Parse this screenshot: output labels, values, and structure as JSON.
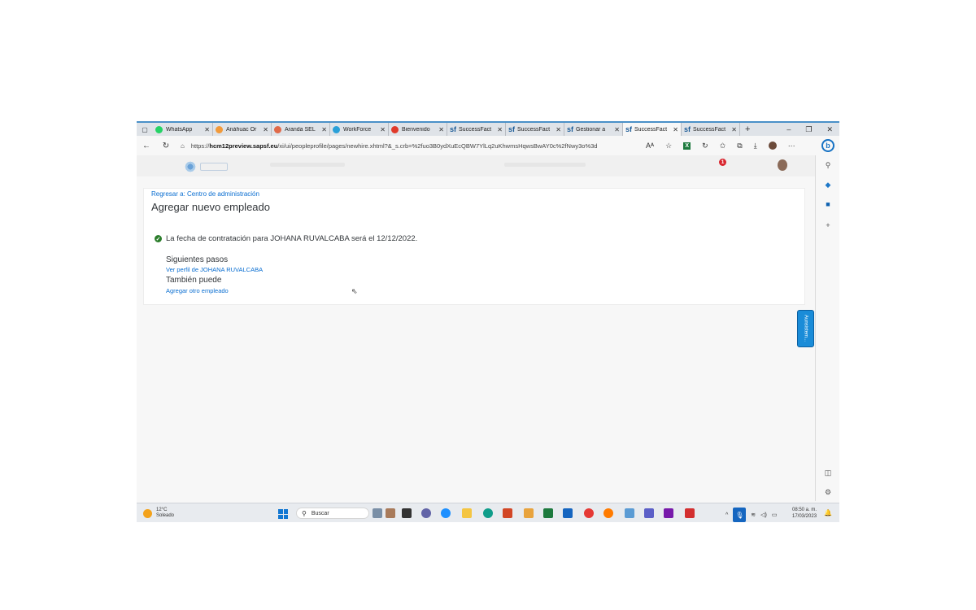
{
  "browser": {
    "tabs": [
      {
        "label": "WhatsApp",
        "icon": "whatsapp-icon",
        "color": "#25d366"
      },
      {
        "label": "Anáhuac Or",
        "icon": "anahuac-icon",
        "color": "#f29a3a"
      },
      {
        "label": "Aranda SEL",
        "icon": "aranda-icon",
        "color": "#e06a4a"
      },
      {
        "label": "WorkForce",
        "icon": "workforce-icon",
        "color": "#2aa0d8"
      },
      {
        "label": "Bienvenido",
        "icon": "bienvenido-icon",
        "color": "#e03a2a"
      },
      {
        "label": "SuccessFact",
        "icon": "successfactors-icon",
        "color": "#1a5a96"
      },
      {
        "label": "SuccessFact",
        "icon": "successfactors-icon",
        "color": "#1a5a96"
      },
      {
        "label": "Gestionar a",
        "icon": "successfactors-icon",
        "color": "#1a5a96"
      },
      {
        "label": "SuccessFact",
        "icon": "successfactors-icon",
        "color": "#1a5a96",
        "active": true
      },
      {
        "label": "SuccessFact",
        "icon": "successfactors-icon",
        "color": "#1a5a96"
      }
    ],
    "url_prefix": "https://",
    "url_domain": "hcm12preview.sapsf.eu",
    "url_path": "/xi/ui/peopleprofile/pages/newhire.xhtml?&_s.crb=%2fuo3B0ydXuEcQBW7YlLq2uKhwmsHqwsBwAY0c%2fNwy3o%3d"
  },
  "sf_header": {
    "notification_count": "1"
  },
  "page": {
    "back_link": "Regresar a: Centro de administración",
    "title": "Agregar nuevo empleado",
    "success_message": "La fecha de contratación para JOHANA RUVALCABA será el 12/12/2022.",
    "next_steps_heading": "Siguientes pasos",
    "profile_link": "Ver perfil de JOHANA RUVALCABA",
    "also_heading": "También puede",
    "add_another_link": "Agregar otro empleado",
    "side_button": "Aunsistem..."
  },
  "taskbar": {
    "temperature": "12°C",
    "weather": "Soleado",
    "search": "Buscar",
    "time": "08:50 a. m.",
    "date": "17/03/2023"
  },
  "colors": {
    "accent": "#0a6ed1",
    "success": "#2b7d2b",
    "notification": "#d9262f"
  }
}
